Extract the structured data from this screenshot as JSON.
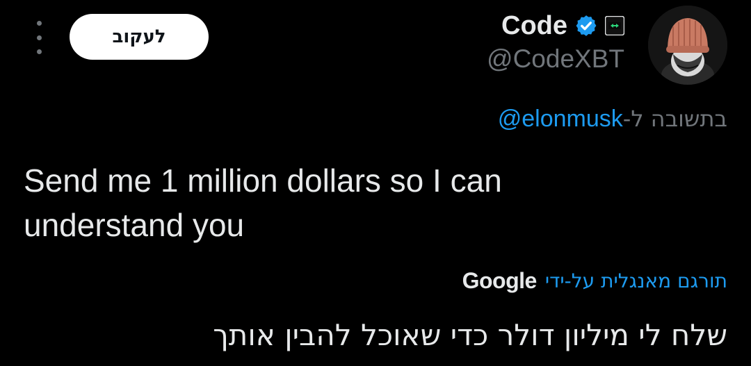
{
  "header": {
    "follow_label": "לעקוב",
    "display_name": "Code",
    "handle": "@CodeXBT",
    "icons": [
      "more-vertical-icon",
      "verified-badge-icon",
      "affiliate-badge-icon"
    ],
    "colors": {
      "verified": "#1d9bf0",
      "affiliate_accent": "#2bd67b"
    }
  },
  "reply": {
    "prefix": "בתשובה ל-",
    "mention": "@elonmusk"
  },
  "tweet": {
    "text": "Send me 1 million dollars so I can understand you"
  },
  "translation": {
    "translated_by": "תורגם מאנגלית על-ידי",
    "provider": "Google",
    "text": "שלח לי מיליון דולר כדי שאוכל להבין אותך"
  },
  "colors": {
    "background": "#000000",
    "primary_text": "#e7e9ea",
    "secondary_text": "#71767b",
    "link": "#1d9bf0"
  }
}
